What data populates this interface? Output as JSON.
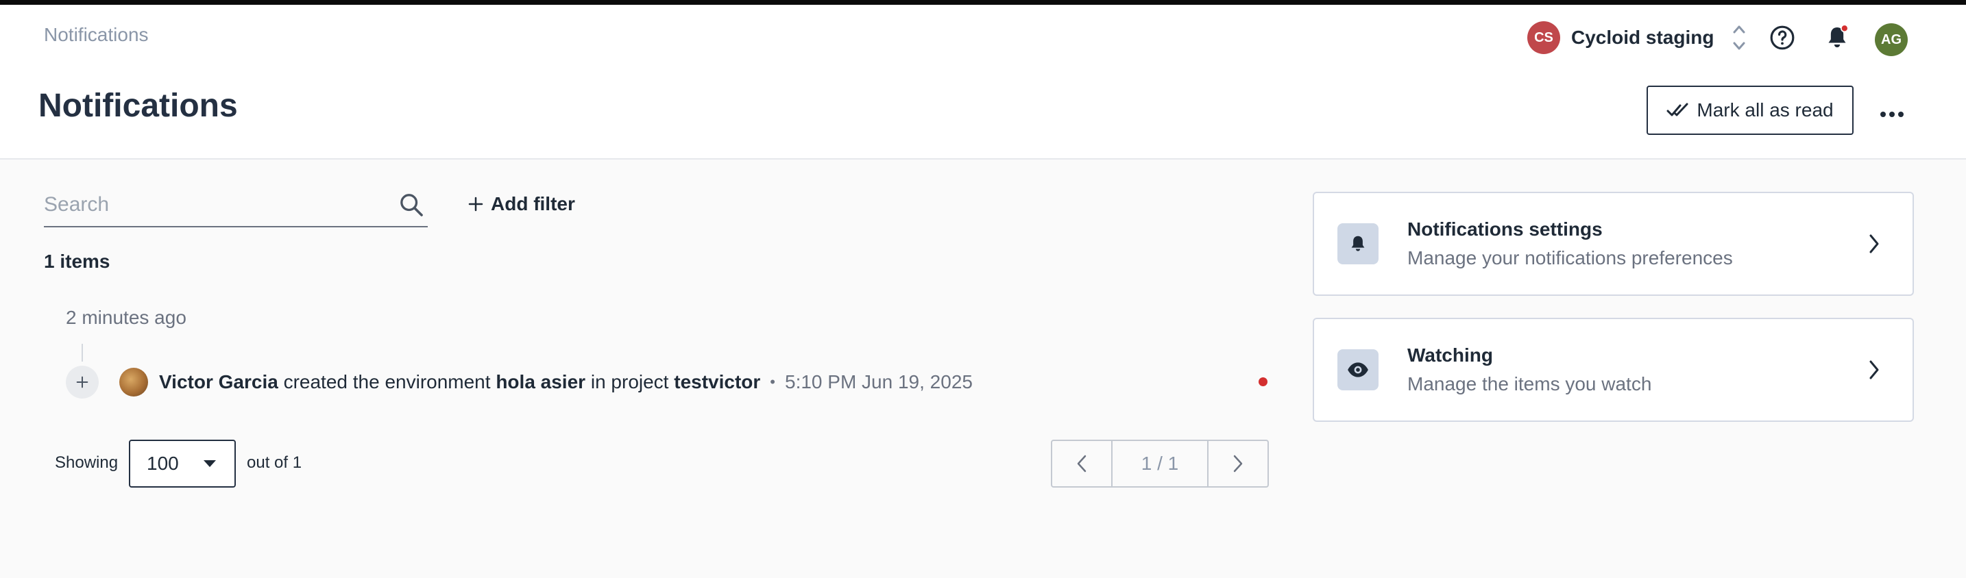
{
  "header": {
    "breadcrumb": "Notifications",
    "title": "Notifications",
    "org": {
      "initials": "CS",
      "name": "Cycloid staging",
      "color": "#c0474b"
    },
    "user_initials": "AG",
    "user_color": "#5c7a35",
    "help_icon": "help-circle-icon",
    "bell_icon": "bell-icon",
    "mark_all_label": "Mark all as read",
    "more_icon": "more-horizontal-icon"
  },
  "toolbar": {
    "search_placeholder": "Search",
    "add_filter_label": "Add filter"
  },
  "list": {
    "count_label": "1 items",
    "groups": [
      {
        "time_label": "2 minutes ago",
        "items": [
          {
            "actor": "Victor Garcia",
            "action": "created the environment",
            "target": "hola asier",
            "connector": "in project",
            "project": "testvictor",
            "separator": "•",
            "timestamp": "5:10 PM Jun 19, 2025",
            "unread": true
          }
        ]
      }
    ]
  },
  "pagination": {
    "showing_label": "Showing",
    "page_size": "100",
    "out_of_label": "out of 1",
    "page_label": "1 / 1"
  },
  "side_cards": [
    {
      "title": "Notifications settings",
      "description": "Manage your notifications preferences",
      "icon": "bell-icon"
    },
    {
      "title": "Watching",
      "description": "Manage the items you watch",
      "icon": "eye-icon"
    }
  ],
  "colors": {
    "accent_dark": "#243042",
    "unread_dot": "#d32f2f",
    "card_icon_bg": "#cfd8e6"
  }
}
